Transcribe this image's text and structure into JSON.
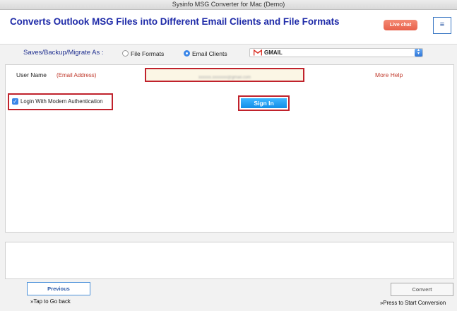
{
  "window": {
    "title": "Sysinfo MSG Converter for Mac (Demo)"
  },
  "header": {
    "title": "Converts Outlook MSG Files into Different Email Clients and File Formats",
    "live_chat": "Live chat",
    "menu_icon": "≡"
  },
  "save_options": {
    "label": "Saves/Backup/Migrate As :",
    "file_formats": "File Formats",
    "email_clients": "Email Clients",
    "selected": "Email Clients",
    "client_value": "GMAIL"
  },
  "login": {
    "username_label": "User Name",
    "email_hint": "(Email Address)",
    "username_value": "xxxxxx.xxxxxxx@gmail.com",
    "more_help": "More Help",
    "modern_auth_label": "Login With Modern Authentication",
    "modern_auth_checked": true,
    "sign_in": "Sign In"
  },
  "footer": {
    "previous": "Previous",
    "previous_hint": "»Tap to Go back",
    "convert": "Convert",
    "convert_hint": "»Press to Start Conversion"
  },
  "colors": {
    "title_blue": "#1e2aa8",
    "highlight_red": "#c0222c",
    "sign_in_blue": "#128ee8",
    "live_chat": "#e8604a"
  }
}
